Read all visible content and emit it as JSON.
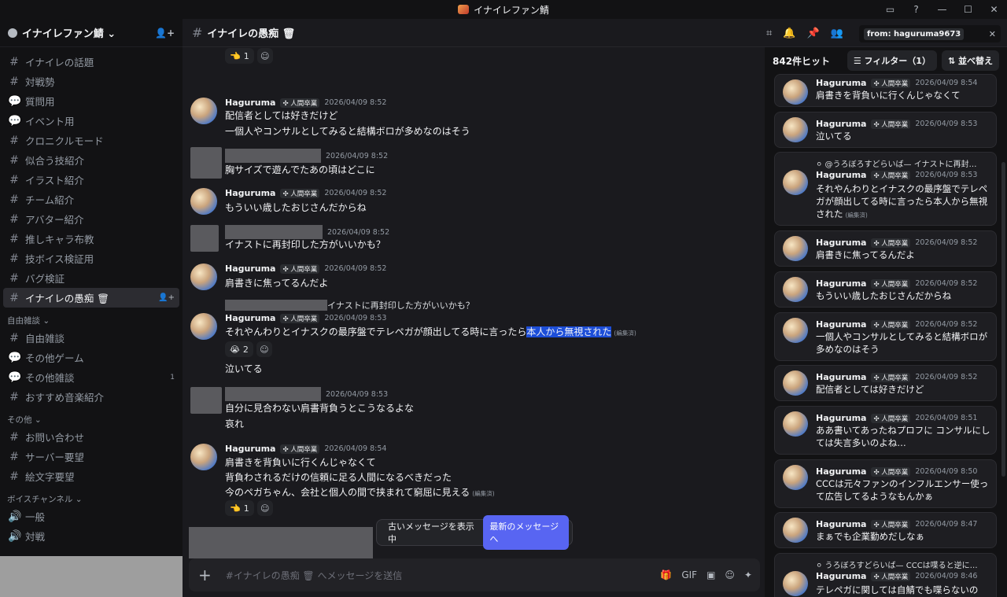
{
  "window": {
    "title": "イナイレファン鯖",
    "controls": [
      "▭",
      "?",
      "—",
      "☐",
      "✕"
    ]
  },
  "server": {
    "name": "イナイレファン鯖 ⌄"
  },
  "sidebar": {
    "channels_top": [
      {
        "label": "イナイレの話題",
        "icon": "#"
      },
      {
        "label": "対戦勢",
        "icon": "#"
      },
      {
        "label": "質問用",
        "icon": "💬"
      },
      {
        "label": "イベント用",
        "icon": "💬"
      },
      {
        "label": "クロニクルモード",
        "icon": "#"
      },
      {
        "label": "似合う技紹介",
        "icon": "#"
      },
      {
        "label": "イラスト紹介",
        "icon": "#"
      },
      {
        "label": "チーム紹介",
        "icon": "#"
      },
      {
        "label": "アバター紹介",
        "icon": "#"
      },
      {
        "label": "推しキャラ布教",
        "icon": "#"
      },
      {
        "label": "技ボイス検証用",
        "icon": "#"
      },
      {
        "label": "バグ検証",
        "icon": "#"
      },
      {
        "label": "イナイレの愚痴 🗑",
        "icon": "#"
      }
    ],
    "cat_free": "自由雑談 ⌄",
    "channels_free": [
      {
        "label": "自由雑談",
        "icon": "#",
        "badge": ""
      },
      {
        "label": "その他ゲーム",
        "icon": "💬",
        "badge": ""
      },
      {
        "label": "その他雑談",
        "icon": "💬",
        "badge": "1"
      },
      {
        "label": "おすすめ音楽紹介",
        "icon": "#",
        "badge": ""
      }
    ],
    "cat_other": "その他 ⌄",
    "channels_other": [
      {
        "label": "お問い合わせ",
        "icon": "#"
      },
      {
        "label": "サーバー要望",
        "icon": "#"
      },
      {
        "label": "絵文字要望",
        "icon": "#"
      }
    ],
    "cat_voice": "ボイスチャンネル ⌄",
    "channels_voice": [
      {
        "label": "一般",
        "icon": "🔊"
      },
      {
        "label": "対戦",
        "icon": "🔊"
      }
    ]
  },
  "header": {
    "channel": "イナイレの愚痴 🗑",
    "search_token": "from: haguruma9673"
  },
  "messages": {
    "r0": {
      "emoji": "👈",
      "count": "1"
    },
    "m1": {
      "user": "Haguruma",
      "role": "✣ 人間卒業",
      "time": "2026/04/09 8:52",
      "l1": "配信者としては好きだけど",
      "l2": "一個人やコンサルとしてみると結構ボロが多めなのはそう"
    },
    "m2": {
      "time": "2026/04/09 8:52",
      "l1": "胸サイズで遊んでたあの頃はどこに"
    },
    "m3": {
      "user": "Haguruma",
      "role": "✣ 人間卒業",
      "time": "2026/04/09 8:52",
      "l1": "もういい歳したおじさんだからね"
    },
    "m4": {
      "time": "2026/04/09 8:52",
      "l1": "イナストに再封印した方がいいかも？"
    },
    "m5": {
      "user": "Haguruma",
      "role": "✣ 人間卒業",
      "time": "2026/04/09 8:52",
      "l1": "肩書きに焦ってるんだよ"
    },
    "m6": {
      "reply": "イナストに再封印した方がいいかも？",
      "user": "Haguruma",
      "role": "✣ 人間卒業",
      "time": "2026/04/09 8:53",
      "l1a": "それやんわりとイナスクの最序盤でテレペガが顔出してる時に言ったら",
      "l1b": "本人から無視された",
      "edited": "(編集済)",
      "react_emoji": "😭",
      "react_count": "2",
      "l2": "泣いてる"
    },
    "m7": {
      "time": "2026/04/09 8:53",
      "l1": "自分に見合わない肩書背負うとこうなるよな",
      "l2": "哀れ"
    },
    "m8": {
      "user": "Haguruma",
      "role": "✣ 人間卒業",
      "time": "2026/04/09 8:54",
      "l1": "肩書きを背負いに行くんじゃなくて",
      "l2": "背負わされるだけの信頼に足る人間になるべきだった",
      "l3": "今のペガちゃん、会社と個人の間で挟まれて窮屈に見える",
      "edited": "(編集済)",
      "react_emoji": "👈",
      "react_count": "1"
    }
  },
  "jump_bar": {
    "old": "古いメッセージを表示中",
    "new": "最新のメッセージへ"
  },
  "composer": {
    "placeholder": "#イナイレの愚痴 🗑 へメッセージを送信"
  },
  "results": {
    "count": "842件ヒット",
    "filter": "☰ フィルター（1）",
    "sort": "⇅ 並べ替え",
    "items": [
      {
        "user": "Haguruma",
        "role": "✣ 人間卒業",
        "time": "2026/04/09 8:54",
        "text": "肩書きを背負いに行くんじゃなくて"
      },
      {
        "user": "Haguruma",
        "role": "✣ 人間卒業",
        "time": "2026/04/09 8:53",
        "text": "泣いてる"
      },
      {
        "reply": "⚪ @うろぼろすどらいば— イナストに再封…",
        "user": "Haguruma",
        "role": "✣ 人間卒業",
        "time": "2026/04/09 8:53",
        "text": "それやんわりとイナスクの最序盤でテレペガが顔出してる時に言ったら本人から無視された",
        "edited": "(編集済)"
      },
      {
        "user": "Haguruma",
        "role": "✣ 人間卒業",
        "time": "2026/04/09 8:52",
        "text": "肩書きに焦ってるんだよ"
      },
      {
        "user": "Haguruma",
        "role": "✣ 人間卒業",
        "time": "2026/04/09 8:52",
        "text": "もういい歳したおじさんだからね"
      },
      {
        "user": "Haguruma",
        "role": "✣ 人間卒業",
        "time": "2026/04/09 8:52",
        "text": "一個人やコンサルとしてみると結構ボロが多めなのはそう"
      },
      {
        "user": "Haguruma",
        "role": "✣ 人間卒業",
        "time": "2026/04/09 8:52",
        "text": "配信者としては好きだけど"
      },
      {
        "user": "Haguruma",
        "role": "✣ 人間卒業",
        "time": "2026/04/09 8:51",
        "text": "ああ書いてあったねプロフに コンサルにしては失言多いのよね…"
      },
      {
        "user": "Haguruma",
        "role": "✣ 人間卒業",
        "time": "2026/04/09 8:50",
        "text": "CCCは元々ファンのインフルエンサー使って広告してるようなもんかぁ"
      },
      {
        "user": "Haguruma",
        "role": "✣ 人間卒業",
        "time": "2026/04/09 8:47",
        "text": "まぁでも企業勤めだしなぁ"
      },
      {
        "reply": "⚪ うろぼろすどらいば— CCCは喋ると逆に…",
        "user": "Haguruma",
        "role": "✣ 人間卒業",
        "time": "2026/04/09 8:46",
        "text": "テレペガに関しては自鯖でも喋らないの"
      }
    ]
  }
}
